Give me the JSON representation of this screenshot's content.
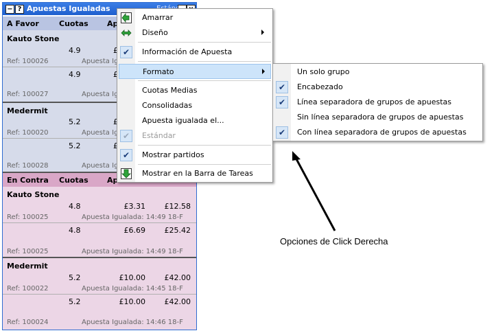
{
  "window": {
    "title": "Apuestas Igualadas",
    "title_right_text": "Estándar",
    "minimize_glyph": "−",
    "help_glyph": "?",
    "close_glyph": "×"
  },
  "favor_header": {
    "col1": "A Favor",
    "col2": "Cuotas",
    "col3": "Ap"
  },
  "contra_header": {
    "col1": "En Contra",
    "col2": "Cuotas",
    "col3": "Ap"
  },
  "favor_groups": [
    {
      "name": "Kauto Stone",
      "rows": [
        {
          "odds": "4.9",
          "v1": "£",
          "v2": "",
          "ref": "Ref: 100026",
          "apuesta": "Apuesta Ig"
        },
        {
          "odds": "4.9",
          "v1": "£",
          "v2": "",
          "ref": "Ref: 100027",
          "apuesta": "Apuesta Ig"
        }
      ]
    },
    {
      "name": "Medermit",
      "rows": [
        {
          "odds": "5.2",
          "v1": "£",
          "v2": "",
          "ref": "Ref: 100020",
          "apuesta": "Apuesta Ig"
        },
        {
          "odds": "5.2",
          "v1": "£",
          "v2": "",
          "ref": "Ref: 100028",
          "apuesta": "Apuesta Ig"
        }
      ]
    }
  ],
  "contra_groups": [
    {
      "name": "Kauto Stone",
      "rows": [
        {
          "odds": "4.8",
          "v1": "£3.31",
          "v2": "£12.58",
          "ref": "Ref: 100025",
          "apuesta": "Apuesta Igualada: 14:49  18-F"
        },
        {
          "odds": "4.8",
          "v1": "£6.69",
          "v2": "£25.42",
          "ref": "Ref: 100025",
          "apuesta": "Apuesta Igualada: 14:49  18-F"
        }
      ]
    },
    {
      "name": "Medermit",
      "rows": [
        {
          "odds": "5.2",
          "v1": "£10.00",
          "v2": "£42.00",
          "ref": "Ref: 100022",
          "apuesta": "Apuesta Igualada: 14:45  18-F"
        },
        {
          "odds": "5.2",
          "v1": "£10.00",
          "v2": "£42.00",
          "ref": "Ref: 100024",
          "apuesta": "Apuesta Igualada: 14:46  18-F"
        }
      ]
    }
  ],
  "main_menu": {
    "amarrar": "Amarrar",
    "diseno": "Diseño",
    "informacion": "Información de Apuesta",
    "formato": "Formato",
    "cuotas_medias": "Cuotas Medias",
    "consolidadas": "Consolidadas",
    "apuesta_igualada_el": "Apuesta igualada el...",
    "estandar": "Estándar",
    "mostrar_partidos": "Mostrar partidos",
    "mostrar_barra": "Mostrar en la Barra de Tareas",
    "check_glyph": "✔"
  },
  "submenu": {
    "un_solo_grupo": "Un solo grupo",
    "encabezado": "Encabezado",
    "linea_separadora": "Línea separadora de grupos de apuestas",
    "sin_linea": "Sin línea separadora de grupos de apuestas",
    "con_linea": "Con línea separadora de grupos de apuestas"
  },
  "annotation": "Opciones de Click Derecha",
  "colors": {
    "title_bar": "#1f5fce",
    "favor_header": "#b9c4e2",
    "favor_bg": "#d6dbea",
    "contra_header": "#d9a7c7",
    "contra_bg": "#ecd6e6",
    "menu_highlight": "#cde4fa"
  }
}
